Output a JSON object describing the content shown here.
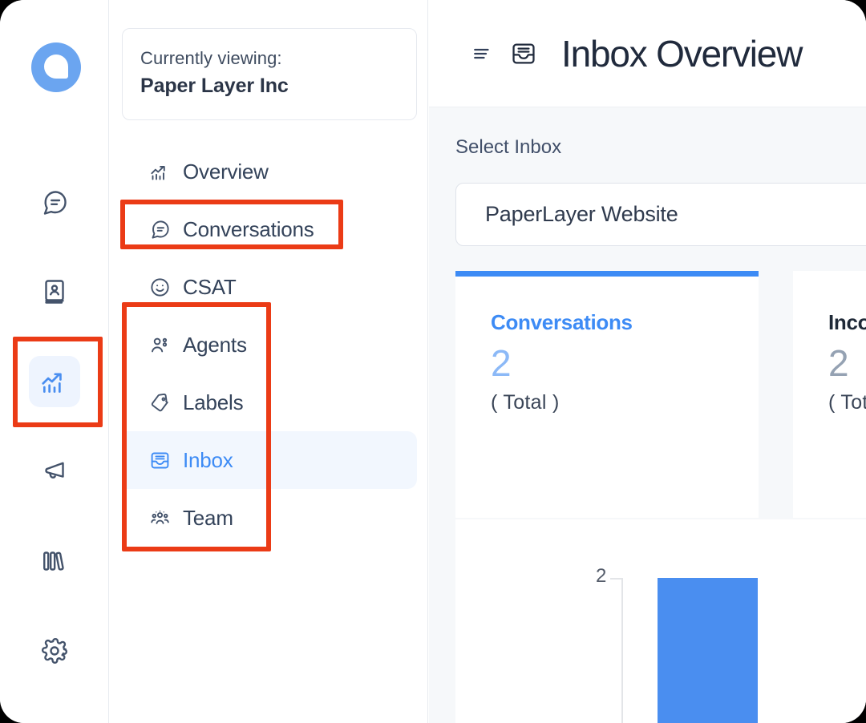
{
  "app": {
    "brand_icon": "chatwoot-logo-icon",
    "accent_color": "#3d8bf5",
    "annotation_color": "#eb3b16"
  },
  "icon_rail": {
    "items": [
      {
        "name": "conversations",
        "icon": "chat-bubble-icon",
        "active": false
      },
      {
        "name": "contacts",
        "icon": "contact-book-icon",
        "active": false
      },
      {
        "name": "reports",
        "icon": "analytics-trend-icon",
        "active": true
      },
      {
        "name": "campaigns",
        "icon": "megaphone-icon",
        "active": false
      },
      {
        "name": "portal",
        "icon": "books-icon",
        "active": false
      },
      {
        "name": "settings",
        "icon": "gear-icon",
        "active": false
      }
    ]
  },
  "sidebar": {
    "viewing": {
      "label": "Currently viewing:",
      "value": "Paper Layer Inc"
    },
    "nav_items": [
      {
        "label": "Overview",
        "icon": "trend-chart-icon",
        "active": false
      },
      {
        "label": "Conversations",
        "icon": "chat-bubble-icon",
        "active": false
      },
      {
        "label": "CSAT",
        "icon": "smiley-icon",
        "active": false
      },
      {
        "label": "Agents",
        "icon": "people-icon",
        "active": false
      },
      {
        "label": "Labels",
        "icon": "tag-icon",
        "active": false
      },
      {
        "label": "Inbox",
        "icon": "inbox-icon",
        "active": true
      },
      {
        "label": "Team",
        "icon": "team-icon",
        "active": false
      }
    ]
  },
  "main": {
    "header": {
      "menu_icon": "hamburger-menu-icon",
      "title_icon": "inbox-icon",
      "title": "Inbox Overview"
    },
    "select_inbox": {
      "label": "Select Inbox",
      "value": "PaperLayer Website"
    },
    "metrics": [
      {
        "title": "Conversations",
        "value": "2",
        "sub": "( Total )",
        "accent": true
      },
      {
        "title": "Incoming Messages",
        "value": "2",
        "sub": "( Total )",
        "accent": false
      }
    ]
  },
  "chart_data": {
    "type": "bar",
    "title": "",
    "categories": [
      ""
    ],
    "values": [
      2
    ],
    "series": [
      {
        "name": "Conversations",
        "values": [
          2
        ],
        "color": "#4a8ef0"
      }
    ],
    "xlabel": "",
    "ylabel": "",
    "ylim": [
      0,
      2
    ],
    "y_ticks": [
      "2"
    ],
    "grid": false,
    "legend": "none"
  }
}
